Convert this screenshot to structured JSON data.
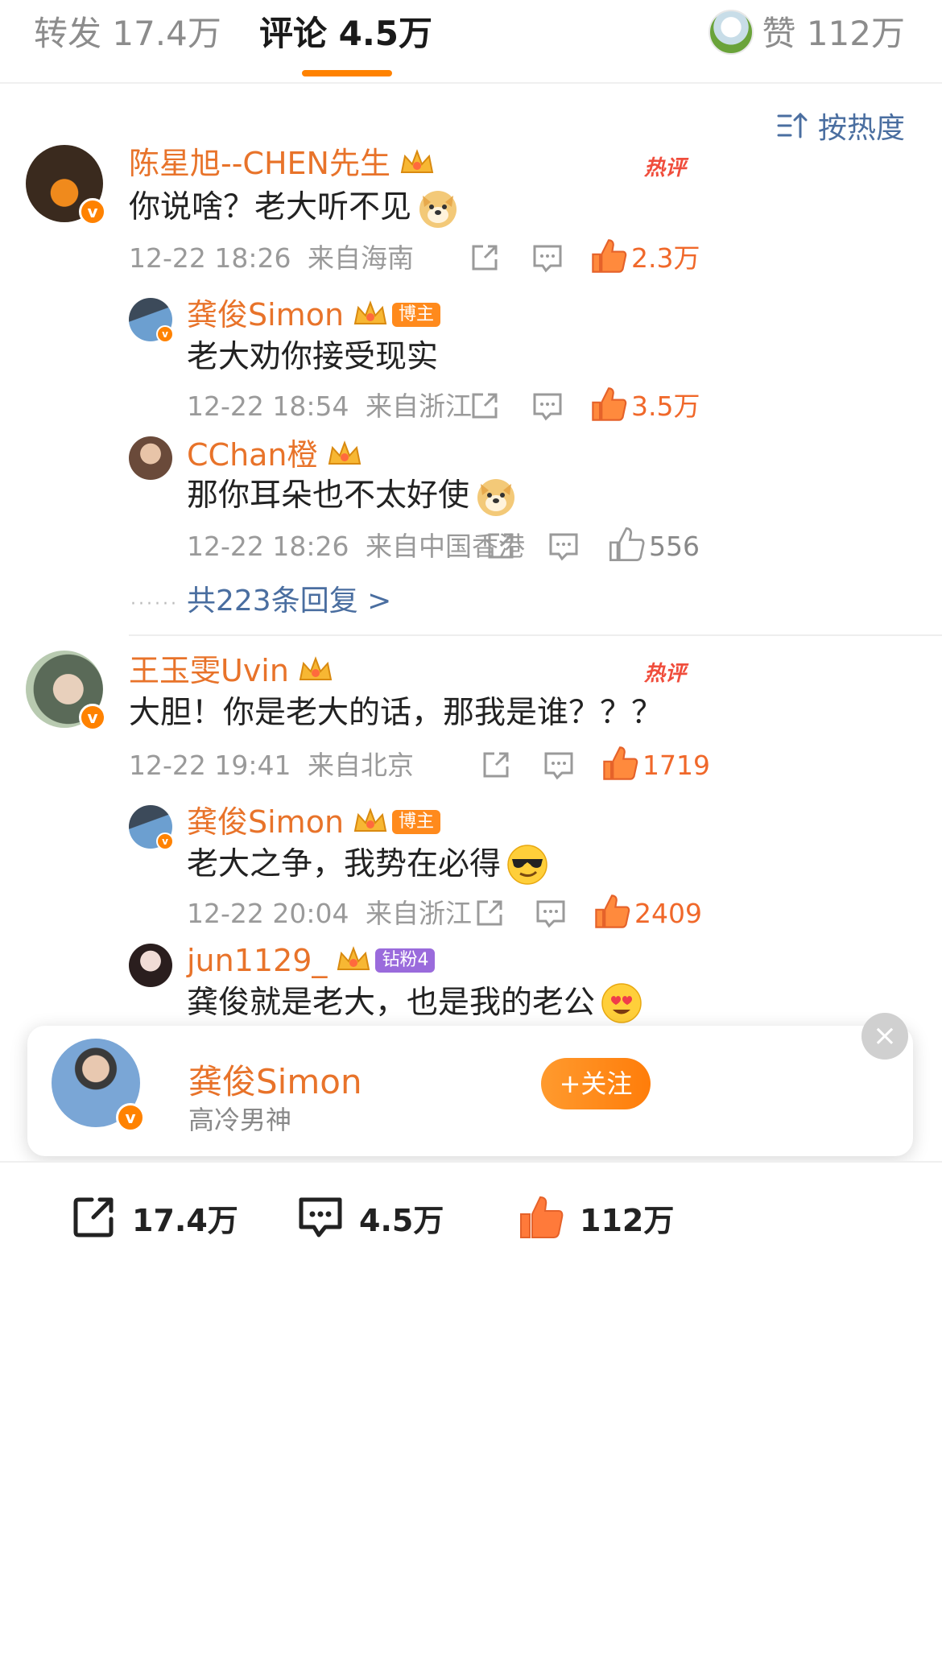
{
  "tabs": {
    "repost": "转发 17.4万",
    "comment": "评论 4.5万",
    "like": "赞 112万"
  },
  "sort": {
    "label": "按热度"
  },
  "colors": {
    "accent": "#ff8200",
    "name": "#e8732a",
    "link": "#4a6ea0",
    "like_active": "#f0682a"
  },
  "hot_label": "热评",
  "comments": [
    {
      "user": "陈星旭--CHEN先生",
      "text": "你说啥？老大听不见",
      "emoji": "doge-emoji",
      "time": "12-22 18:26",
      "source": "来自海南",
      "likes": "2.3万",
      "liked": true,
      "replies": [
        {
          "user": "龚俊Simon",
          "tag": "博主",
          "text": "老大劝你接受现实",
          "time": "12-22 18:54",
          "source": "来自浙江",
          "likes": "3.5万",
          "liked": true
        },
        {
          "user": "CChan橙",
          "text": "那你耳朵也不太好使",
          "emoji": "doge-emoji",
          "time": "12-22 18:26",
          "source": "来自中国香港",
          "likes": "556",
          "liked": false
        }
      ],
      "more_replies": "共223条回复 >"
    },
    {
      "user": "王玉雯Uvin",
      "text": "大胆！你是老大的话，那我是谁？？？",
      "time": "12-22 19:41",
      "source": "来自北京",
      "likes": "1719",
      "liked": true,
      "replies": [
        {
          "user": "龚俊Simon",
          "tag": "博主",
          "text": "老大之争，我势在必得",
          "emoji": "cool-emoji",
          "time": "12-22 20:04",
          "source": "来自浙江",
          "likes": "2409",
          "liked": true
        },
        {
          "user": "jun1129_",
          "tag": "钻粉4",
          "text": "龚俊就是老大，也是我的老公",
          "emoji": "heart-eyes-emoji"
        }
      ]
    }
  ],
  "follow_card": {
    "name": "龚俊Simon",
    "desc": "高冷男神",
    "button": "+关注",
    "close": "×"
  },
  "bottom_bar": {
    "repost": "17.4万",
    "comment": "4.5万",
    "like": "112万"
  }
}
